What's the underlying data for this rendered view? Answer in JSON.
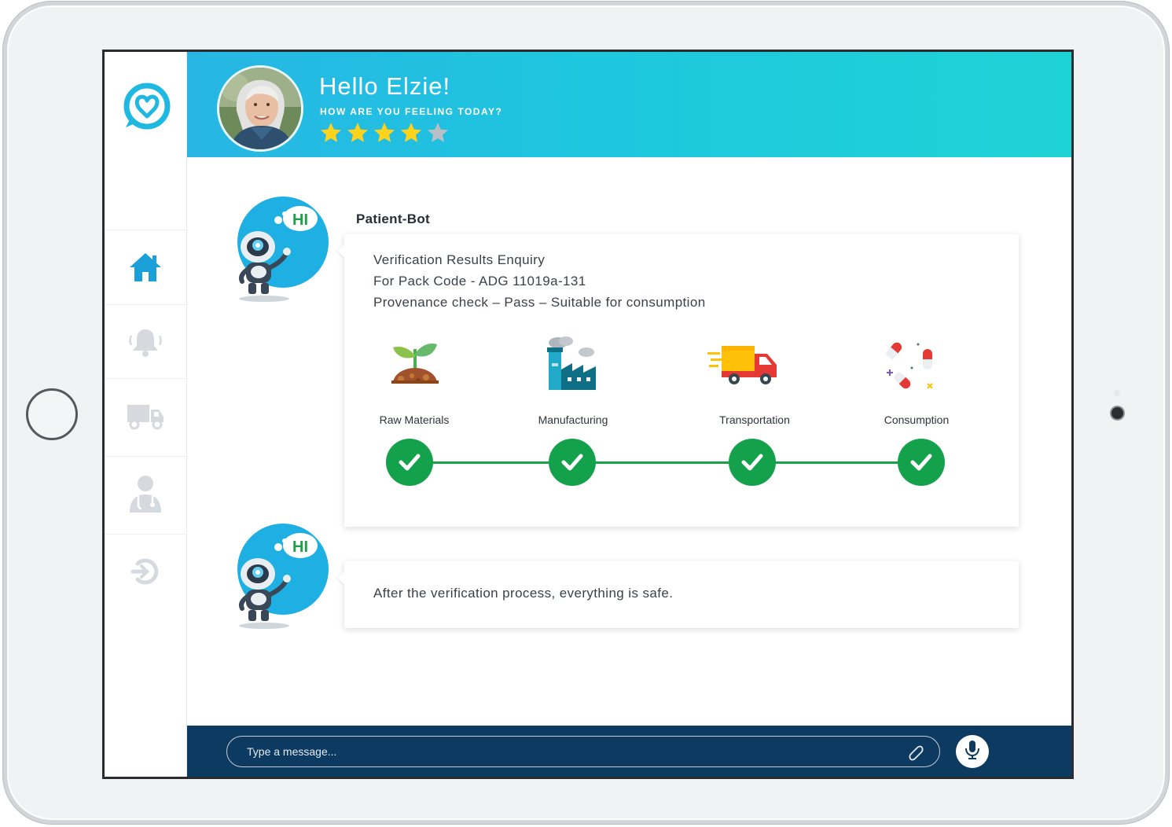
{
  "header": {
    "greeting": "Hello Elzie!",
    "subtitle": "HOW ARE YOU FEELING TODAY?",
    "rating": 4,
    "rating_max": 5,
    "star_color": "#ffd21c",
    "star_empty_color": "#b8bfc5"
  },
  "sidebar": {
    "items": [
      {
        "name": "home",
        "icon": "home-icon",
        "active": true
      },
      {
        "name": "notifications",
        "icon": "bell-icon",
        "active": false
      },
      {
        "name": "delivery",
        "icon": "truck-icon",
        "active": false
      },
      {
        "name": "doctor",
        "icon": "doctor-icon",
        "active": false
      },
      {
        "name": "logout",
        "icon": "logout-icon",
        "active": false
      }
    ]
  },
  "chat": {
    "bot_name": "Patient-Bot",
    "bot_greeting": "HI",
    "message1": {
      "lines": [
        "Verification Results Enquiry",
        "For Pack Code - ADG 11019a-131",
        "Provenance check – Pass – Suitable for consumption"
      ],
      "stages": [
        {
          "label": "Raw Materials",
          "icon": "plant-icon",
          "status": "passed"
        },
        {
          "label": "Manufacturing",
          "icon": "factory-icon",
          "status": "passed"
        },
        {
          "label": "Transportation",
          "icon": "truck-icon",
          "status": "passed"
        },
        {
          "label": "Consumption",
          "icon": "pills-icon",
          "status": "passed"
        }
      ]
    },
    "message2": {
      "text": "After the verification process, everything is safe."
    }
  },
  "composer": {
    "placeholder": "Type a message..."
  },
  "colors": {
    "accent": "#1fb8e0",
    "header_gradient_start": "#27b6e4",
    "header_gradient_end": "#1ed3d6",
    "success": "#13a14b",
    "bottom_bar": "#0d3a60"
  }
}
